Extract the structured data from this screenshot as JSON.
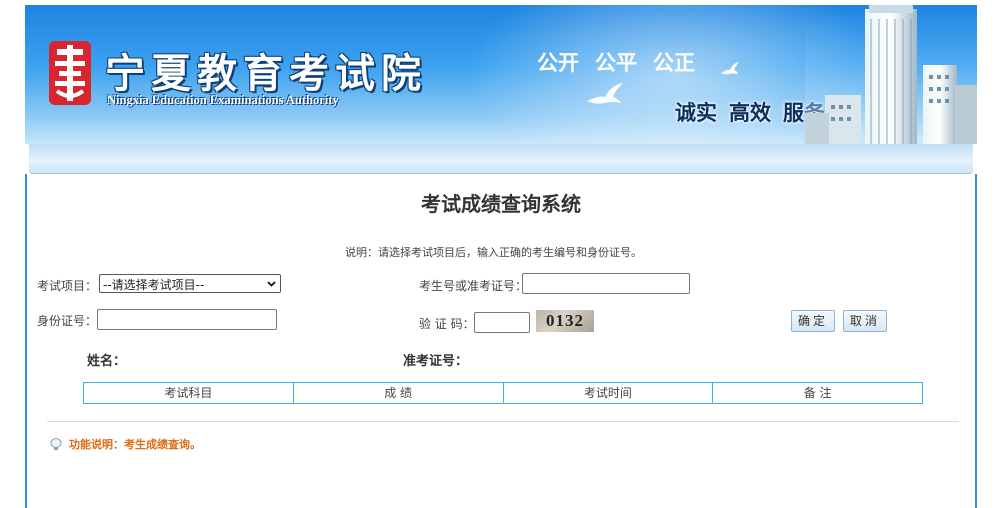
{
  "header": {
    "logo_title": "宁夏教育考试院",
    "logo_subtitle": "Ningxia Education Examinations Authority",
    "slogan_top": [
      "公开",
      "公平",
      "公正"
    ],
    "slogan_bottom": [
      "诚实",
      "高效",
      "服务"
    ]
  },
  "page": {
    "title": "考试成绩查询系统",
    "instruction": "说明：请选择考试项目后，输入正确的考生编号和身份证号。"
  },
  "form": {
    "exam_item_label": "考试项目：",
    "exam_item_value": "--请选择考试项目--",
    "candidate_no_label": "考生号或准考证号：",
    "candidate_no_value": "",
    "id_card_label": "身份证号：",
    "id_card_value": "",
    "captcha_label": "验 证 码：",
    "captcha_value": "",
    "captcha_image_text": "0132",
    "confirm_button": "确定",
    "cancel_button": "取消"
  },
  "result": {
    "name_label": "姓名：",
    "ticket_label": "准考证号：",
    "columns": [
      "考试科目",
      "成 绩",
      "考试时间",
      "备 注"
    ]
  },
  "footer": {
    "function_note": "功能说明：考生成绩查询。"
  },
  "colors": {
    "accent_blue": "#2b8fe3",
    "table_border": "#37b5ea",
    "note_orange": "#e06c13",
    "emblem_red": "#d7262f"
  }
}
